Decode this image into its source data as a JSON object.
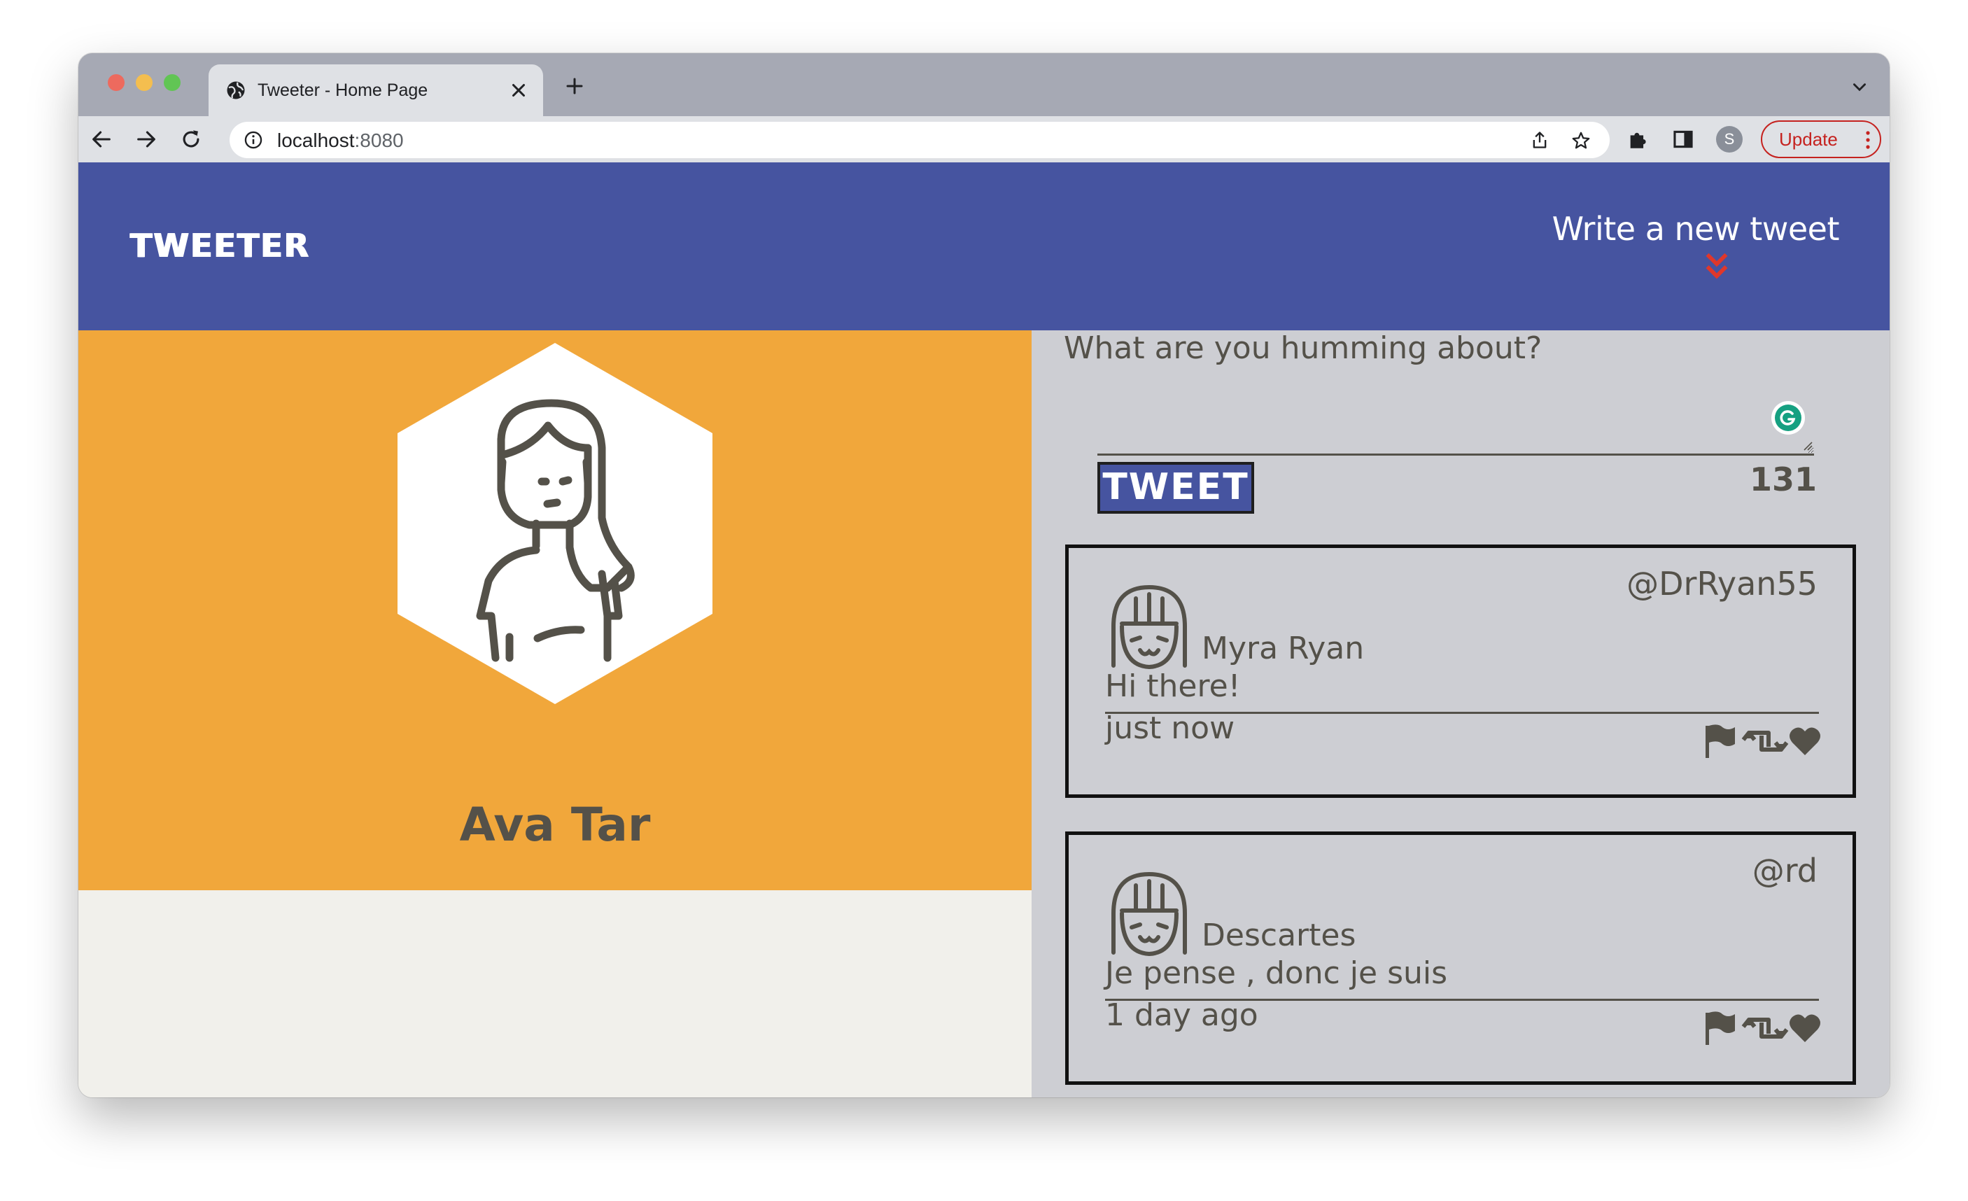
{
  "browser": {
    "tab_title": "Tweeter - Home Page",
    "url_host": "localhost",
    "url_port": ":8080",
    "avatar_letter": "S",
    "update_label": "Update"
  },
  "nav": {
    "brand": "TWEETER",
    "compose_label": "Write a new tweet"
  },
  "profile": {
    "name": "Ava Tar"
  },
  "composer": {
    "prompt": "What are you humming about?",
    "button_label": "TWEET",
    "counter": "131"
  },
  "tweets": [
    {
      "handle": "@DrRyan55",
      "name": "Myra Ryan",
      "text": "Hi there!",
      "time": "just now"
    },
    {
      "handle": "@rd",
      "name": "Descartes",
      "text": "Je pense , donc je suis",
      "time": "1 day ago"
    }
  ],
  "colors": {
    "nav_bg": "#4654a0",
    "profile_bg": "#f1a73b",
    "feed_bg": "#cdced3",
    "accent_red": "#e0372b",
    "text": "#545149"
  },
  "icons": {
    "compose_arrow": "double-chevron-down-icon",
    "tweet_actions": [
      "flag-icon",
      "retweet-icon",
      "heart-icon"
    ]
  }
}
